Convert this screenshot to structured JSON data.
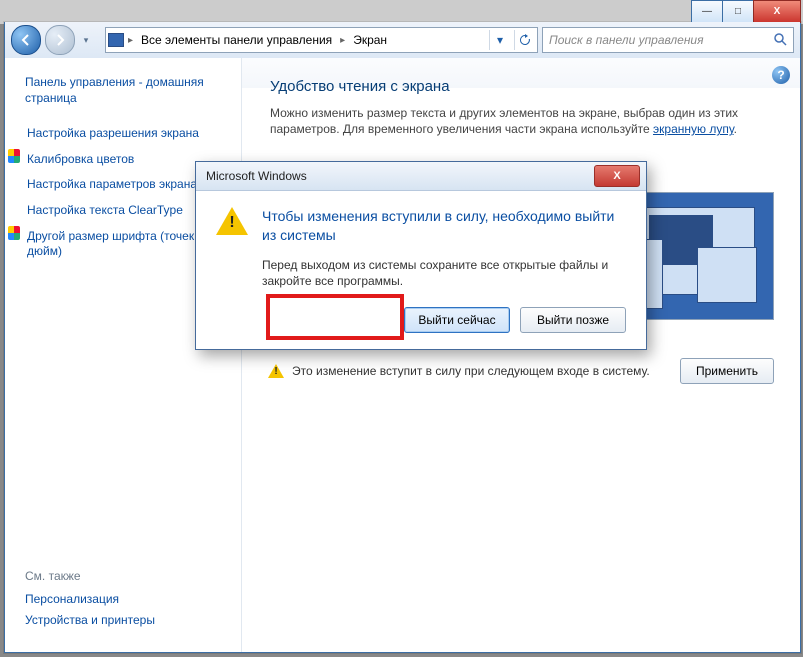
{
  "window_controls": {
    "min": "—",
    "max": "□",
    "close": "X"
  },
  "toolbar": {
    "breadcrumb": [
      "Все элементы панели управления",
      "Экран"
    ],
    "search_placeholder": "Поиск в панели управления"
  },
  "sidebar": {
    "home": "Панель управления - домашняя страница",
    "links": [
      "Настройка разрешения экрана",
      "Калибровка цветов",
      "Настройка параметров экрана",
      "Настройка текста ClearType",
      "Другой размер шрифта (точек на дюйм)"
    ],
    "see_also_head": "См. также",
    "see_also": [
      "Персонализация",
      "Устройства и принтеры"
    ]
  },
  "main": {
    "heading": "Удобство чтения с экрана",
    "desc": "Можно изменить размер текста и других элементов на экране, выбрав один из этих параметров. Для временного увеличения части экрана используйте ",
    "desc_link": "экранную лупу",
    "desc_tail": ".",
    "notice": "Это изменение вступит в силу при следующем входе в систему.",
    "apply": "Применить"
  },
  "dialog": {
    "title": "Microsoft Windows",
    "heading": "Чтобы изменения вступили в силу, необходимо выйти из системы",
    "body": "Перед выходом из системы сохраните все открытые файлы и закройте все программы.",
    "btn_now": "Выйти сейчас",
    "btn_later": "Выйти позже"
  }
}
